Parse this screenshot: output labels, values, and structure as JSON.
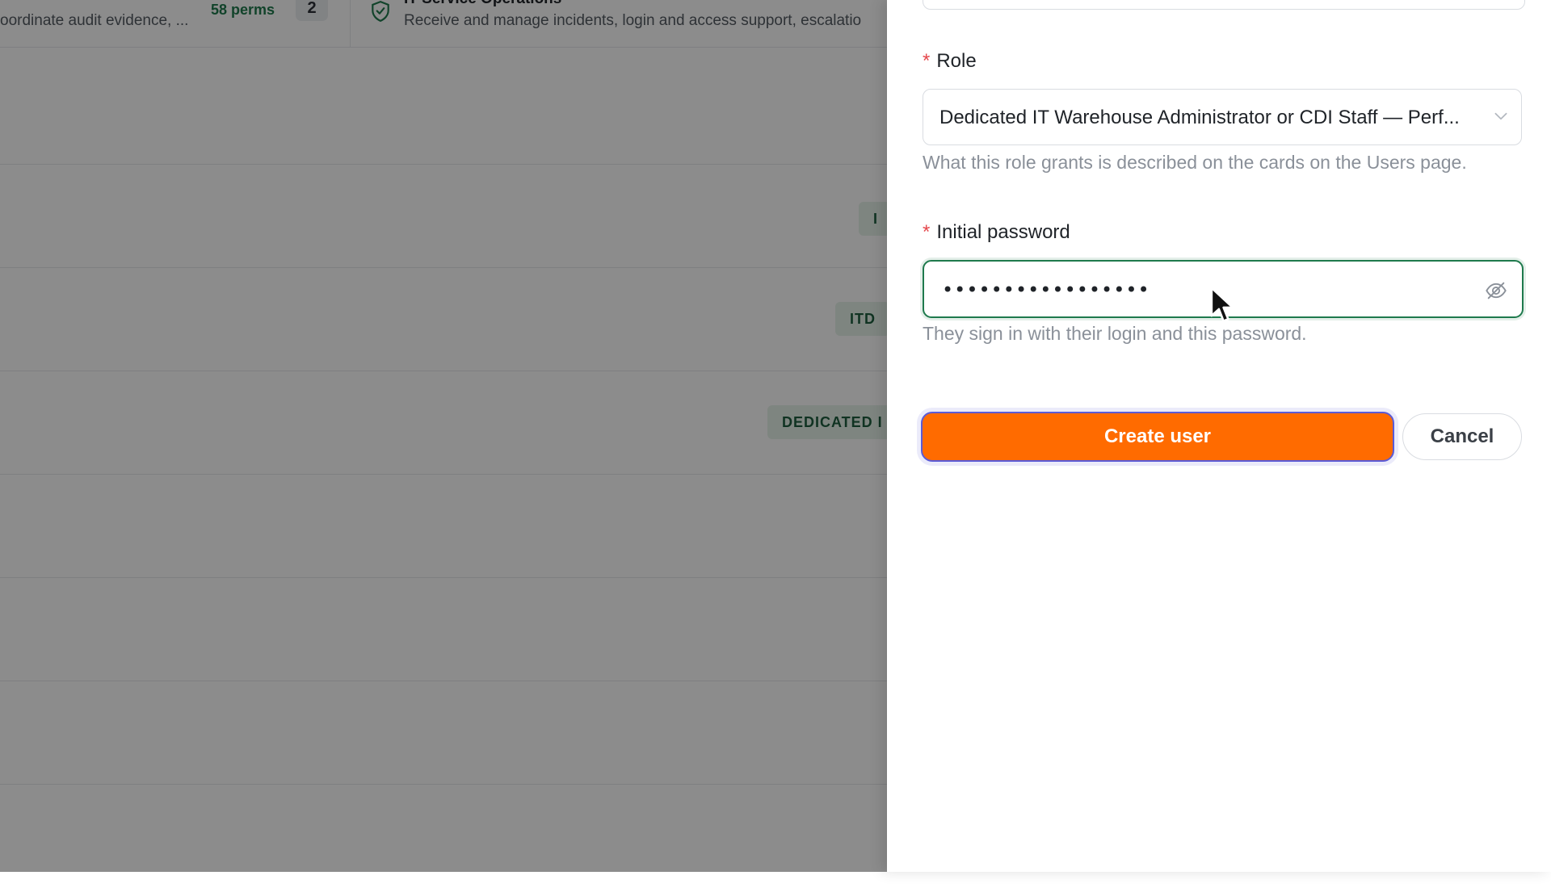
{
  "background": {
    "role_cards": [
      {
        "description": "oordinate audit evidence, ...",
        "perms": "58 perms",
        "count": "2"
      },
      {
        "title": "IT Service Operations",
        "description": "Receive and manage incidents, login and access support, escalatio"
      }
    ],
    "row_tags": [
      "I",
      "ITD",
      "DEDICATED I"
    ]
  },
  "drawer": {
    "role": {
      "required_mark": "*",
      "label": "Role",
      "selected_value": "Dedicated IT Warehouse Administrator or CDI Staff — Perf...",
      "helper": "What this role grants is described on the cards on the Users page."
    },
    "password": {
      "required_mark": "*",
      "label": "Initial password",
      "value": "•••••••••••••••••",
      "helper": "They sign in with their login and this password."
    },
    "actions": {
      "create_label": "Create user",
      "cancel_label": "Cancel"
    }
  },
  "colors": {
    "accent_orange": "#ff6b00",
    "focus_green": "#1f7a4d",
    "required_red": "#e5484d"
  }
}
